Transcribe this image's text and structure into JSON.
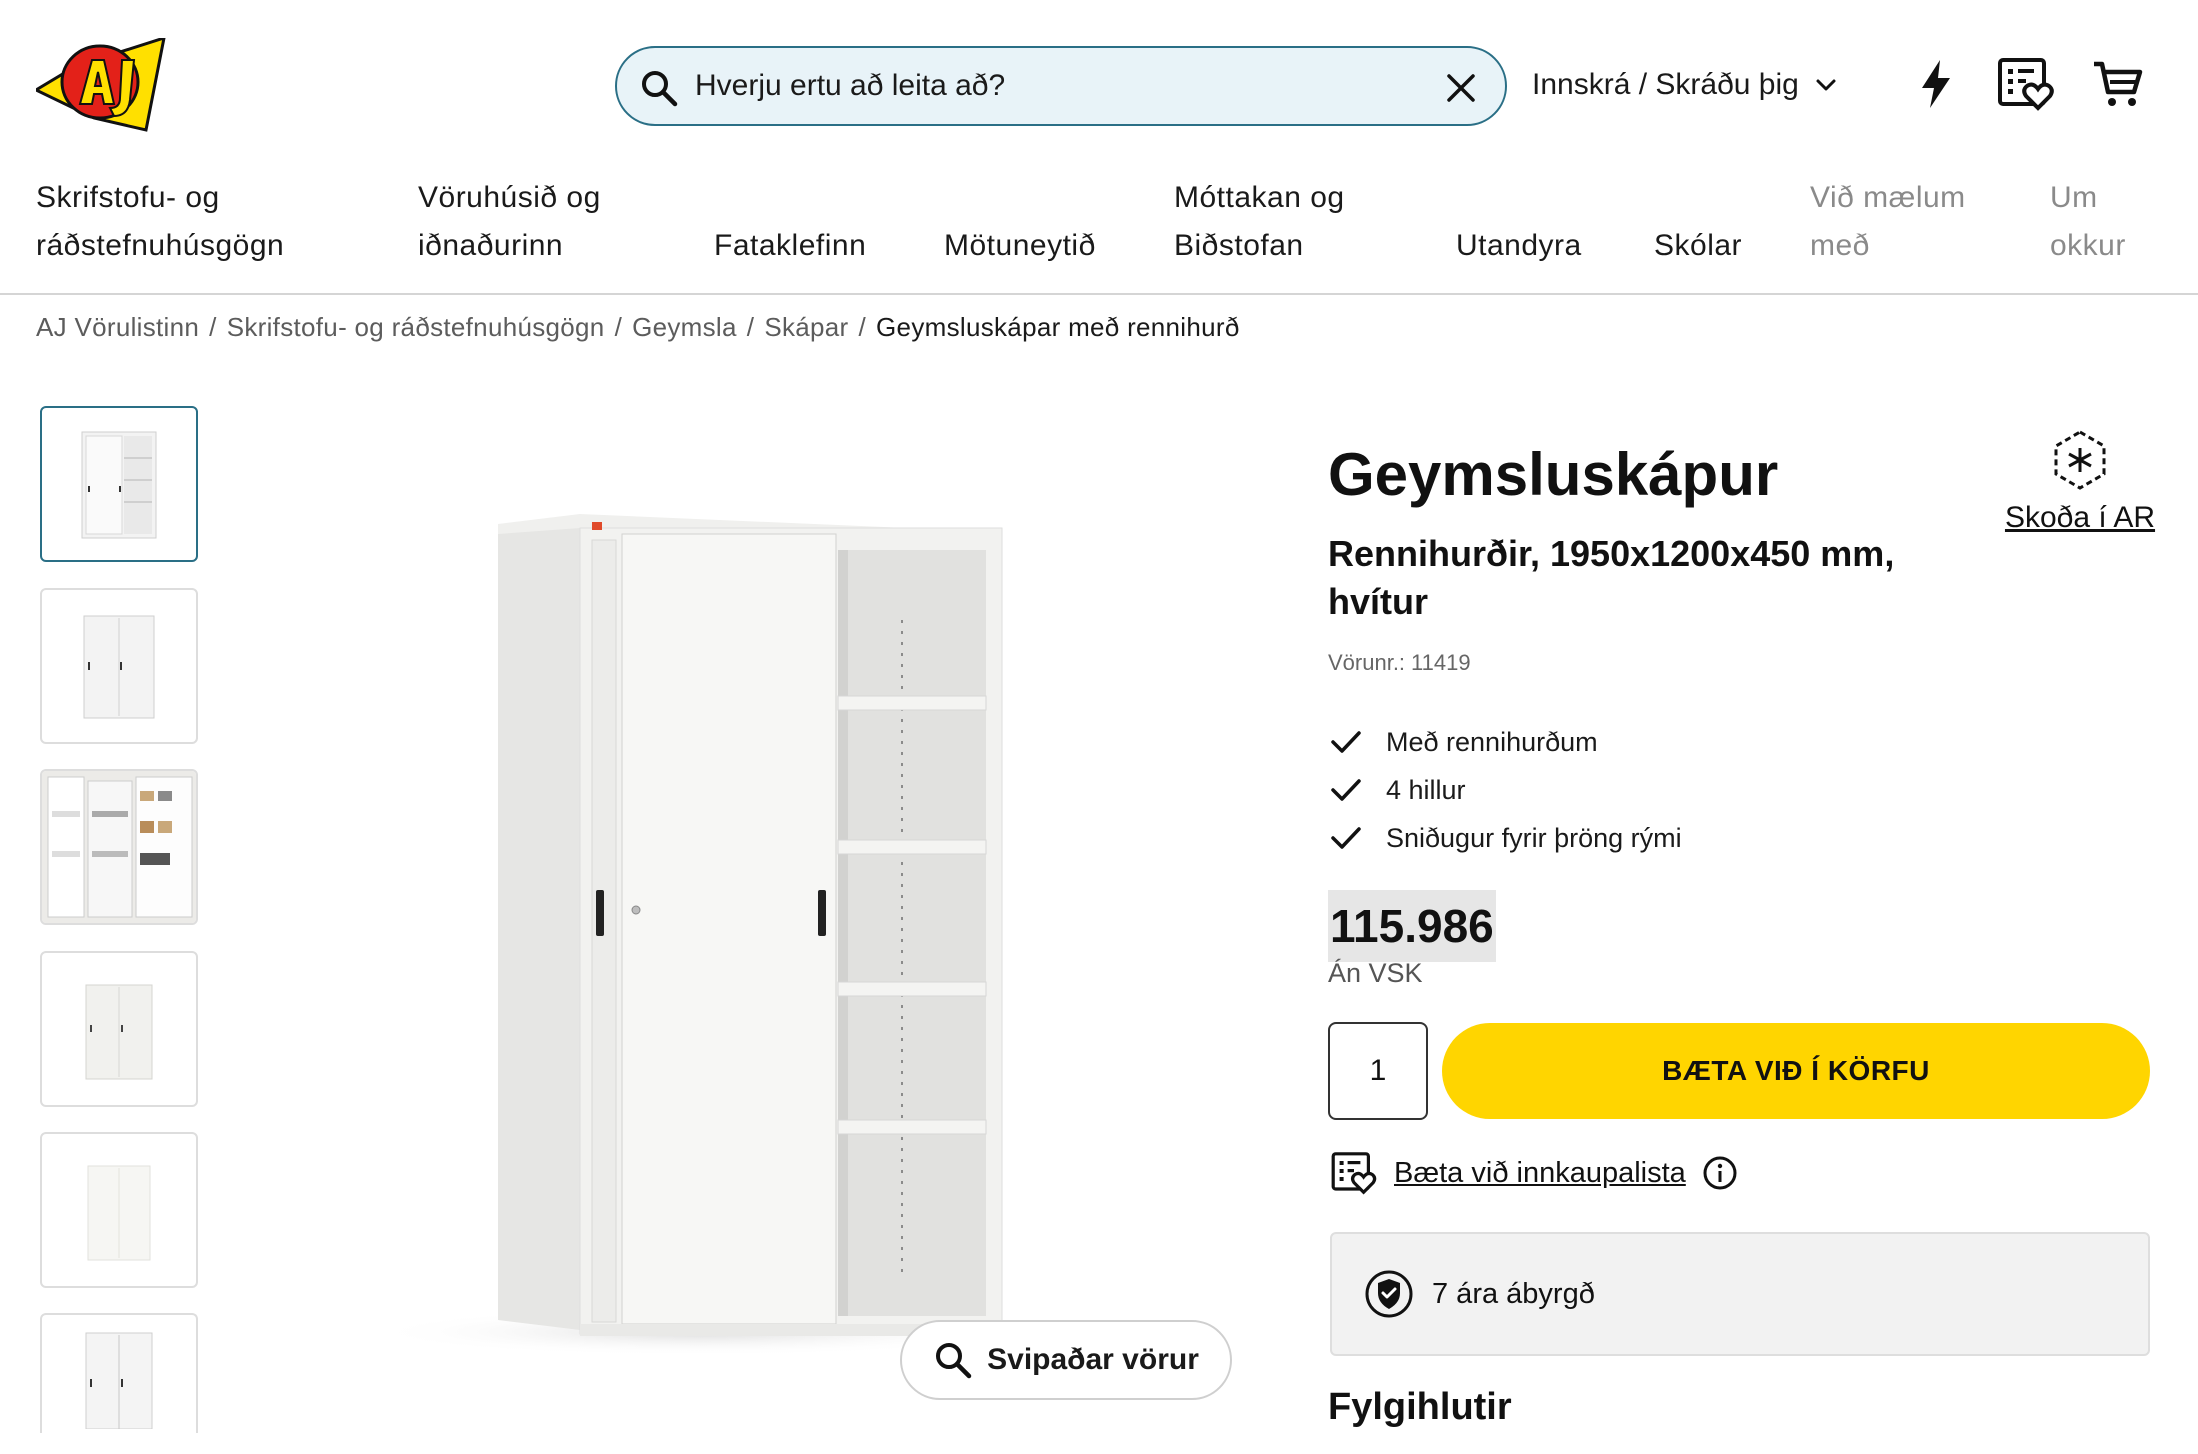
{
  "header": {
    "search_placeholder": "Hverju ertu að leita að?",
    "login_label": "Innskrá / Skráðu þig",
    "icons": [
      "search-icon",
      "clear-icon",
      "chevron-down-icon",
      "quick-order-icon",
      "wishlist-icon",
      "cart-icon"
    ]
  },
  "nav": {
    "items": [
      {
        "line1": "Skrifstofu- og",
        "line2": "ráðstefnuhúsgögn"
      },
      {
        "line1": "Vöruhúsið og",
        "line2": "iðnaðurinn"
      },
      {
        "line1": "",
        "line2": "Fataklefinn"
      },
      {
        "line1": "",
        "line2": "Mötuneytið"
      },
      {
        "line1": "Móttakan og",
        "line2": "Biðstofan"
      },
      {
        "line1": "",
        "line2": "Utandyra"
      },
      {
        "line1": "",
        "line2": "Skólar"
      },
      {
        "line1": "Við mælum",
        "line2": "með"
      },
      {
        "line1": "Um",
        "line2": "okkur"
      }
    ]
  },
  "breadcrumb": {
    "items": [
      "AJ Vörulistinn",
      "Skrifstofu- og ráðstefnuhúsgögn",
      "Geymsla",
      "Skápar"
    ],
    "separator": "/",
    "current": "Geymsluskápar með rennihurð"
  },
  "product": {
    "title": "Geymsluskápur",
    "subtitle": "Rennihurðir, 1950x1200x450 mm, hvítur",
    "sku_label": "Vörunr.:",
    "sku": "11419",
    "ar_label": "Skoða í AR",
    "features": [
      "Með rennihurðum",
      "4 hillur",
      "Sniðugur fyrir þröng rými"
    ],
    "price": "115.986",
    "vat_label": "Án VSK",
    "quantity": "1",
    "add_to_cart": "BÆTA VIÐ Í KÖRFU",
    "wishlist_label": "Bæta við innkaupalista",
    "warranty": "7 ára ábyrgð",
    "similar_label": "Svipaðar vörur",
    "accessories_title": "Fylgihlutir"
  },
  "colors": {
    "accent": "#ffd500",
    "search_border": "#2a6f86",
    "search_bg": "#e8f3f8"
  }
}
